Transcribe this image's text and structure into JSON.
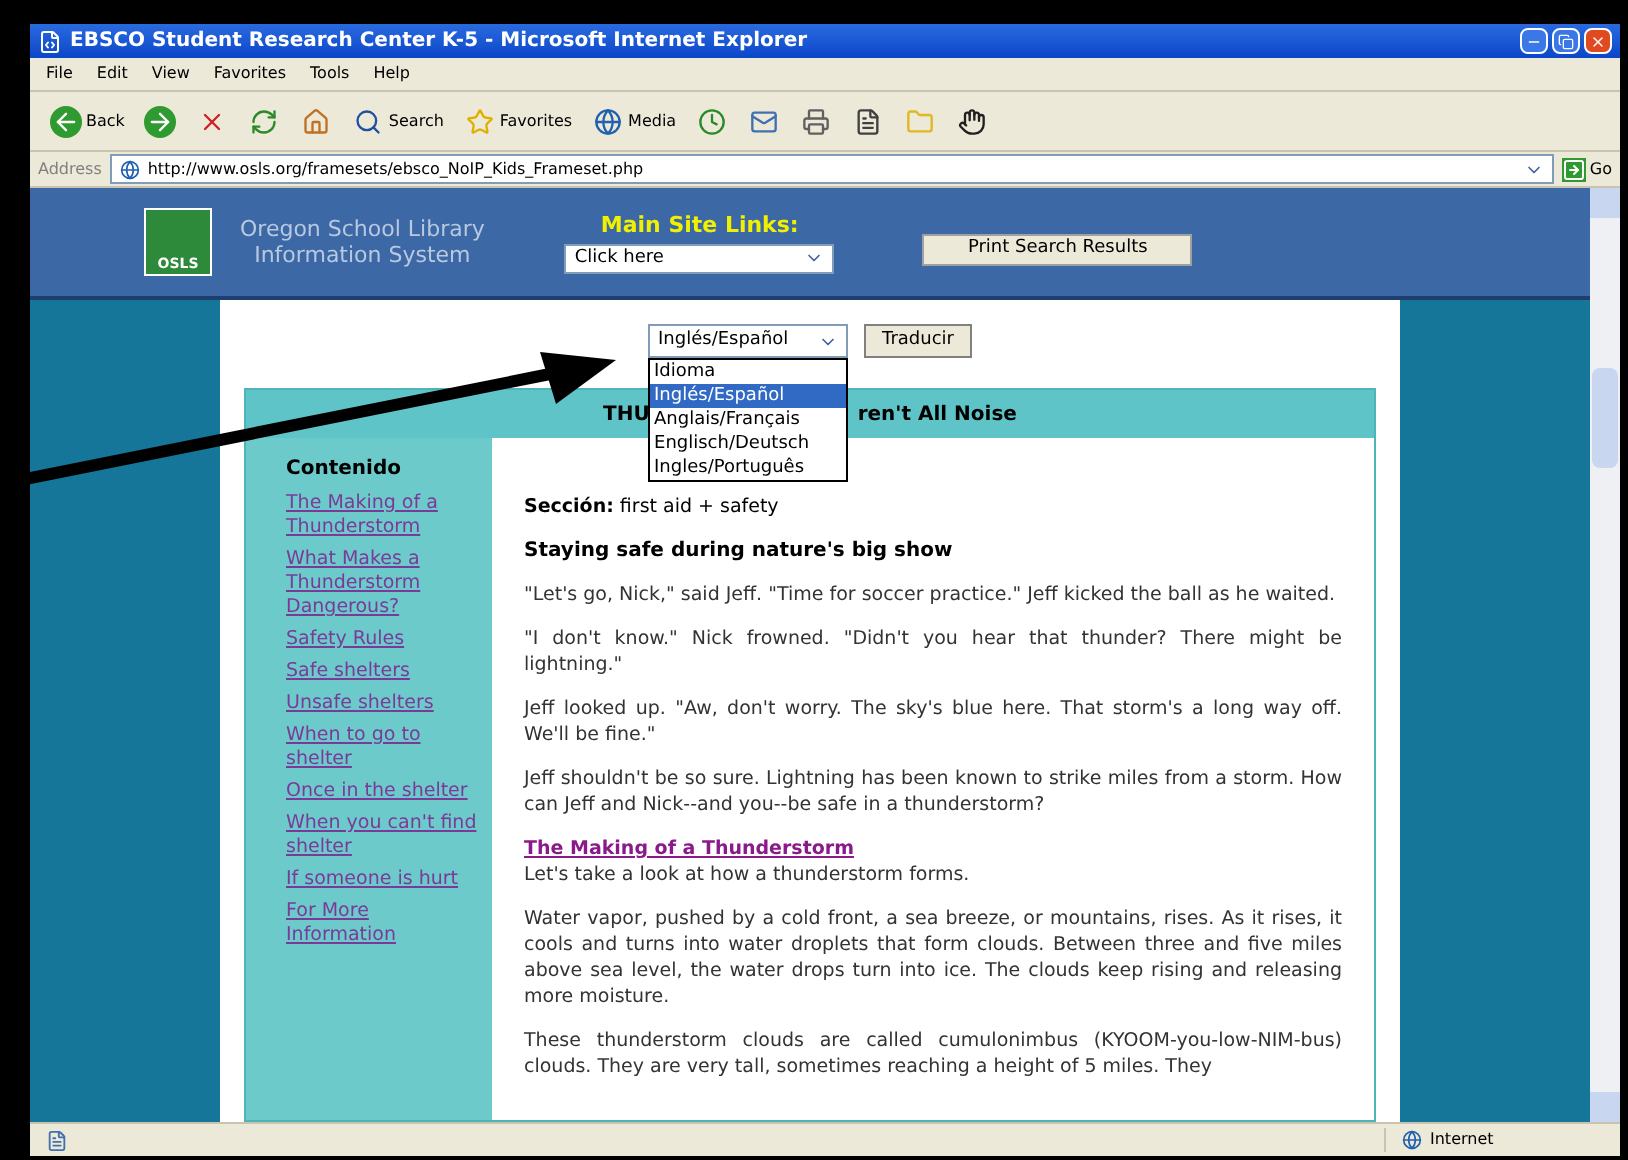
{
  "window": {
    "title": "EBSCO Student Research Center K-5 - Microsoft Internet Explorer"
  },
  "menu": [
    "File",
    "Edit",
    "View",
    "Favorites",
    "Tools",
    "Help"
  ],
  "toolbar": [
    {
      "kind": "back",
      "label": "Back"
    },
    {
      "kind": "forward"
    },
    {
      "kind": "stop"
    },
    {
      "kind": "refresh"
    },
    {
      "kind": "home"
    },
    {
      "kind": "search",
      "label": "Search"
    },
    {
      "kind": "favorites",
      "label": "Favorites"
    },
    {
      "kind": "media",
      "label": "Media"
    },
    {
      "kind": "history"
    },
    {
      "kind": "mail"
    },
    {
      "kind": "print"
    },
    {
      "kind": "edit"
    },
    {
      "kind": "folder"
    },
    {
      "kind": "hand"
    }
  ],
  "address": {
    "label": "Address",
    "value": "http://www.osls.org/framesets/ebsco_NoIP_Kids_Frameset.php",
    "go": "Go"
  },
  "site_header": {
    "logo_text": "OSLS",
    "name_lines": [
      "Oregon School Library",
      "Information System"
    ],
    "links_label": "Main Site Links:",
    "links_select": "Click here",
    "print_button": "Print Search Results"
  },
  "translate": {
    "value": "Inglés/Español",
    "button": "Traducir",
    "options": [
      {
        "label": "Idioma",
        "selected": false
      },
      {
        "label": "Inglés/Español",
        "selected": true
      },
      {
        "label": "Anglais/Français",
        "selected": false
      },
      {
        "label": "Englisch/Deutsch",
        "selected": false
      },
      {
        "label": "Ingles/Português",
        "selected": false
      }
    ]
  },
  "article": {
    "title_start": "THU",
    "title_end": "ren't All Noise",
    "toc_heading": "Contenido",
    "toc": [
      "The Making of a Thunderstorm",
      "What Makes a Thunderstorm Dangerous?",
      "Safety Rules",
      "Safe shelters",
      "Unsafe shelters",
      "When to go to shelter",
      "Once in the shelter",
      "When you can't find shelter",
      "If someone is hurt",
      "For More Information"
    ],
    "section": "**Sección:** first aid + safety",
    "heading": "Staying safe during nature's big show",
    "paragraphs": [
      {
        "kind": "text",
        "text": "\"Let's go, Nick,\" said Jeff. \"Time for soccer practice.\" Jeff kicked the ball as he waited."
      },
      {
        "kind": "text",
        "text": "\"I don't know.\" Nick frowned. \"Didn't you hear that thunder? There might be lightning.\""
      },
      {
        "kind": "text",
        "text": "Jeff looked up. \"Aw, don't worry. The sky's blue here. That storm's a long way off. We'll be fine.\""
      },
      {
        "kind": "text",
        "text": "Jeff shouldn't be so sure. Lightning has been known to strike miles from a storm. How can Jeff and Nick--and you--be safe in a thunderstorm?"
      },
      {
        "kind": "linked",
        "link": "The Making of a Thunderstorm",
        "text": "Let's take a look at how a thunderstorm forms."
      },
      {
        "kind": "text",
        "text": "Water vapor, pushed by a cold front, a sea breeze, or mountains, rises. As it rises, it cools and turns into water droplets that form clouds. Between three and five miles above sea level, the water drops turn into ice. The clouds keep rising and releasing more moisture."
      },
      {
        "kind": "text",
        "text": "These thunderstorm clouds are called cumulonimbus (KYOOM-you-low-NIM-bus) clouds. They are very tall, sometimes reaching a height of 5 miles. They"
      }
    ]
  },
  "status_bar": {
    "zone": "Internet"
  }
}
